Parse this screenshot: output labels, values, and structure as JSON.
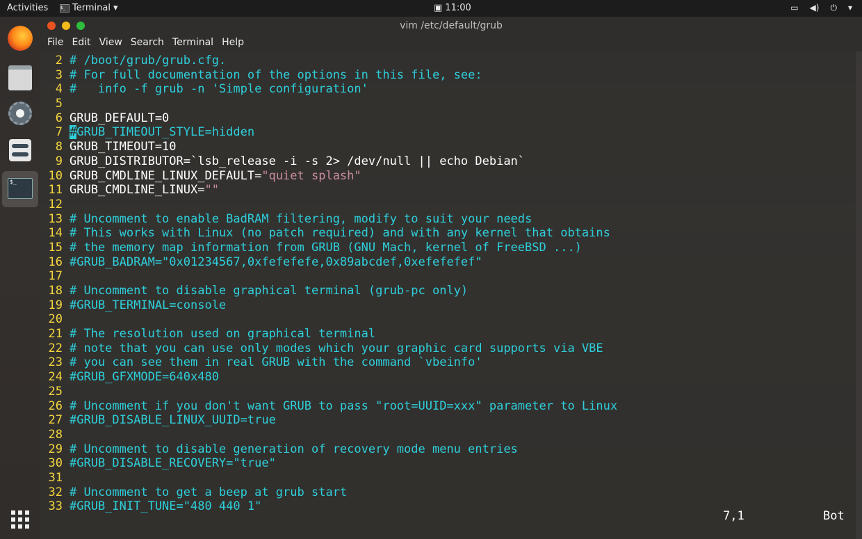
{
  "topbar": {
    "activities": "Activities",
    "app_name": "Terminal",
    "clock": "11:00"
  },
  "dock": {
    "items": [
      "firefox-icon",
      "files-icon",
      "settings-icon",
      "tweaks-icon",
      "terminal-icon",
      "show-applications-icon"
    ]
  },
  "window": {
    "title": "vim /etc/default/grub",
    "menu": [
      "File",
      "Edit",
      "View",
      "Search",
      "Terminal",
      "Help"
    ]
  },
  "editor": {
    "lines": [
      {
        "n": "2",
        "text": "# /boot/grub/grub.cfg.",
        "kind": "comment"
      },
      {
        "n": "3",
        "text": "# For full documentation of the options in this file, see:",
        "kind": "comment"
      },
      {
        "n": "4",
        "text": "#   info -f grub -n 'Simple configuration'",
        "kind": "comment"
      },
      {
        "n": "5",
        "text": "",
        "kind": "plain"
      },
      {
        "n": "6",
        "text": "GRUB_DEFAULT=0",
        "kind": "plain"
      },
      {
        "n": "7",
        "cursor_char": "#",
        "text": "GRUB_TIMEOUT_STYLE=hidden",
        "kind": "cursor"
      },
      {
        "n": "8",
        "text": "GRUB_TIMEOUT=10",
        "kind": "plain"
      },
      {
        "n": "9",
        "text": "GRUB_DISTRIBUTOR=`lsb_release -i -s 2> /dev/null || echo Debian`",
        "kind": "plain"
      },
      {
        "n": "10",
        "text": "GRUB_CMDLINE_LINUX_DEFAULT=",
        "str": "\"quiet splash\"",
        "kind": "string"
      },
      {
        "n": "11",
        "text": "GRUB_CMDLINE_LINUX=",
        "str": "\"\"",
        "kind": "string"
      },
      {
        "n": "12",
        "text": "",
        "kind": "plain"
      },
      {
        "n": "13",
        "text": "# Uncomment to enable BadRAM filtering, modify to suit your needs",
        "kind": "comment"
      },
      {
        "n": "14",
        "text": "# This works with Linux (no patch required) and with any kernel that obtains",
        "kind": "comment"
      },
      {
        "n": "15",
        "text": "# the memory map information from GRUB (GNU Mach, kernel of FreeBSD ...)",
        "kind": "comment"
      },
      {
        "n": "16",
        "text": "#GRUB_BADRAM=\"0x01234567,0xfefefefe,0x89abcdef,0xefefefef\"",
        "kind": "comment"
      },
      {
        "n": "17",
        "text": "",
        "kind": "plain"
      },
      {
        "n": "18",
        "text": "# Uncomment to disable graphical terminal (grub-pc only)",
        "kind": "comment"
      },
      {
        "n": "19",
        "text": "#GRUB_TERMINAL=console",
        "kind": "comment"
      },
      {
        "n": "20",
        "text": "",
        "kind": "plain"
      },
      {
        "n": "21",
        "text": "# The resolution used on graphical terminal",
        "kind": "comment"
      },
      {
        "n": "22",
        "text": "# note that you can use only modes which your graphic card supports via VBE",
        "kind": "comment"
      },
      {
        "n": "23",
        "text": "# you can see them in real GRUB with the command `vbeinfo'",
        "kind": "comment"
      },
      {
        "n": "24",
        "text": "#GRUB_GFXMODE=640x480",
        "kind": "comment"
      },
      {
        "n": "25",
        "text": "",
        "kind": "plain"
      },
      {
        "n": "26",
        "text": "# Uncomment if you don't want GRUB to pass \"root=UUID=xxx\" parameter to Linux",
        "kind": "comment"
      },
      {
        "n": "27",
        "text": "#GRUB_DISABLE_LINUX_UUID=true",
        "kind": "comment"
      },
      {
        "n": "28",
        "text": "",
        "kind": "plain"
      },
      {
        "n": "29",
        "text": "# Uncomment to disable generation of recovery mode menu entries",
        "kind": "comment"
      },
      {
        "n": "30",
        "text": "#GRUB_DISABLE_RECOVERY=\"true\"",
        "kind": "comment"
      },
      {
        "n": "31",
        "text": "",
        "kind": "plain"
      },
      {
        "n": "32",
        "text": "# Uncomment to get a beep at grub start",
        "kind": "comment"
      },
      {
        "n": "33",
        "text": "#GRUB_INIT_TUNE=\"480 440 1\"",
        "kind": "comment"
      }
    ],
    "status_position": "7,1",
    "status_scroll": "Bot"
  },
  "colors": {
    "comment": "#2ecfdb",
    "line_number": "#f5d63f",
    "string": "#c98ca0",
    "close": "#e95420",
    "minimize": "#f4bb1b",
    "maximize": "#2fbd3d"
  }
}
